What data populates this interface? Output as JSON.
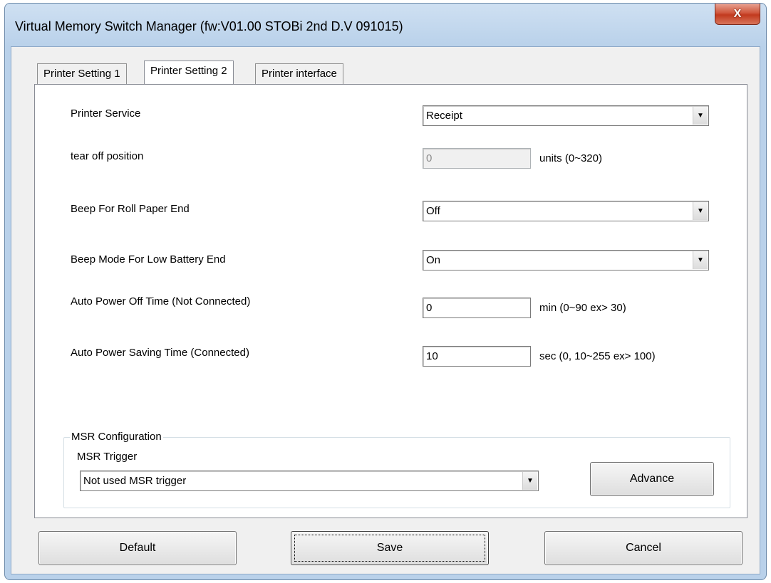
{
  "window": {
    "title": "Virtual Memory Switch Manager  (fw:V01.00 STOBi 2nd D.V 091015)",
    "close_label": "X"
  },
  "tabs": [
    {
      "label": "Printer Setting 1",
      "active": false
    },
    {
      "label": "Printer Setting 2",
      "active": true
    },
    {
      "label": "Printer interface",
      "active": false
    }
  ],
  "settings": {
    "printer_service": {
      "label": "Printer Service",
      "value": "Receipt"
    },
    "tear_off": {
      "label": "tear off position",
      "value": "0",
      "unit": "units (0~320)",
      "disabled": true
    },
    "beep_roll": {
      "label": "Beep For Roll Paper End",
      "value": "Off"
    },
    "beep_battery": {
      "label": "Beep Mode For Low Battery End",
      "value": "On"
    },
    "auto_power_off": {
      "label": "Auto Power Off Time (Not Connected)",
      "value": "0",
      "unit": "min (0~90 ex> 30)"
    },
    "auto_power_saving": {
      "label": "Auto Power Saving Time (Connected)",
      "value": "10",
      "unit": "sec (0, 10~255 ex> 100)"
    }
  },
  "msr": {
    "group_label": "MSR Configuration",
    "trigger_label": "MSR Trigger",
    "trigger_value": "Not used MSR trigger",
    "advance_label": "Advance"
  },
  "buttons": {
    "default_label": "Default",
    "save_label": "Save",
    "cancel_label": "Cancel"
  },
  "icons": {
    "dropdown_arrow": "chevron-down-icon",
    "close": "close-icon"
  }
}
